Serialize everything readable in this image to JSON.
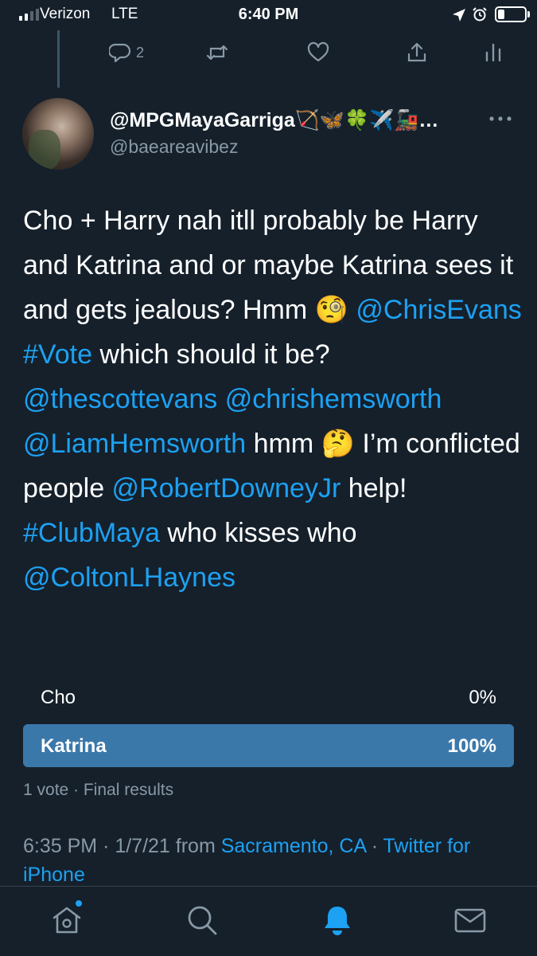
{
  "status_bar": {
    "carrier": "Verizon",
    "network": "LTE",
    "time": "6:40 PM"
  },
  "prev_tweet_actions": {
    "reply_count": "2"
  },
  "tweet": {
    "display_name": "@MPGMayaGarriga🏹🦋🍀✈️🚂…",
    "handle": "@baeareavibez",
    "text": {
      "p1": "Cho + Harry nah itll probably be Harry and Katrina and or maybe Katrina sees it and gets jealous? Hmm 🧐 ",
      "m1": "@ChrisEvans",
      "h1": "#Vote",
      "p2": " which should it be? ",
      "m2": "@thescottevans",
      "m3": "@chrishemsworth",
      "m4": "@LiamHemsworth",
      "p3": " hmm 🤔 I’m conflicted people ",
      "m5": "@RobertDowneyJr",
      "p4": "help! ",
      "h2": "#ClubMaya",
      "p5": " who kisses who ",
      "m6": "@ColtonLHaynes"
    },
    "poll": {
      "options": [
        {
          "label": "Cho",
          "percent": "0%",
          "fraction": 0
        },
        {
          "label": "Katrina",
          "percent": "100%",
          "fraction": 1
        }
      ],
      "summary": "1 vote · Final results"
    },
    "meta": {
      "time_date": "6:35 PM · 1/7/21 from ",
      "location": "Sacramento, CA",
      "sep": " · ",
      "source": "Twitter for iPhone"
    }
  },
  "icons": {
    "reply": "reply-icon",
    "retweet": "retweet-icon",
    "like": "heart-icon",
    "share": "share-icon",
    "analytics": "analytics-icon",
    "more": "more-icon",
    "home": "home-icon",
    "search": "search-icon",
    "notifications": "bell-icon",
    "messages": "mail-icon"
  },
  "colors": {
    "background": "#15202b",
    "accent": "#1da1f2",
    "muted": "#8899a6",
    "poll_bar": "#3b78aa"
  }
}
